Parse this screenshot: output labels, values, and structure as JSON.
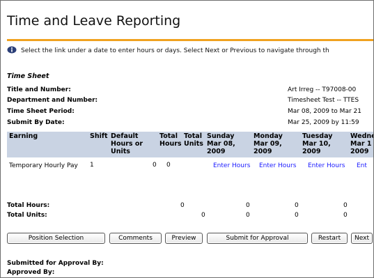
{
  "page_title": "Time and Leave Reporting",
  "info_text": "Select the link under a date to enter hours or days. Select Next or Previous to navigate through th",
  "sheet": {
    "title": "Time Sheet",
    "fields": [
      {
        "label": "Title and Number:",
        "value": "Art Irreg -- T97008-00"
      },
      {
        "label": "Department and Number:",
        "value": "Timesheet Test -- TTES"
      },
      {
        "label": "Time Sheet Period:",
        "value": "Mar 08, 2009 to Mar 21"
      },
      {
        "label": "Submit By Date:",
        "value": "Mar 25, 2009 by 11:59"
      }
    ]
  },
  "table": {
    "headers": {
      "earning": "Earning",
      "shift": "Shift",
      "default": "Default Hours or Units",
      "total_hours": "Total Hours",
      "total_units": "Total Units",
      "sunday": "Sunday Mar 08, 2009",
      "monday": "Monday Mar 09, 2009",
      "tuesday": "Tuesday Mar 10, 2009",
      "wednesday": "Wedne Mar 1 2009"
    },
    "row": {
      "earning": "Temporary Hourly Pay",
      "shift": "1",
      "default": "0",
      "total_hours": "0",
      "sunday_link": "Enter Hours",
      "monday_link": "Enter Hours",
      "tuesday_link": "Enter Hours",
      "wednesday_link": "Ent"
    }
  },
  "totals": {
    "hours_label": "Total Hours:",
    "units_label": "Total Units:",
    "hours_total": "0",
    "units_total": "0",
    "hours_days": [
      "0",
      "0",
      "0"
    ],
    "units_days": [
      "0",
      "0",
      "0"
    ]
  },
  "buttons": {
    "position_selection": "Position Selection",
    "comments": "Comments",
    "preview": "Preview",
    "submit": "Submit for Approval",
    "restart": "Restart",
    "next": "Next"
  },
  "footer": {
    "submitted": "Submitted for Approval By:",
    "approved": "Approved By:"
  },
  "colors": {
    "accent": "#f0a21f",
    "header_bg": "#c9d3e3",
    "link": "#1a1aff"
  }
}
